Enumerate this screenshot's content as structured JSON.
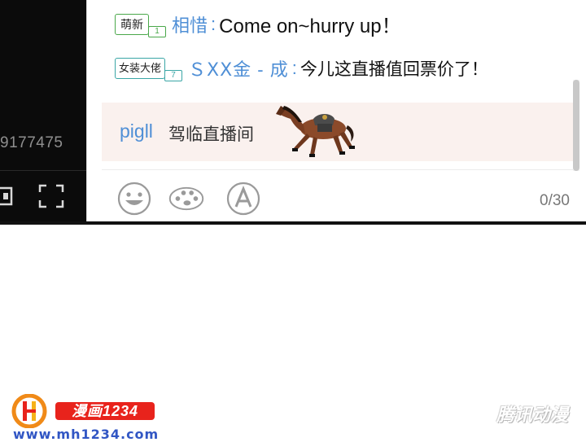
{
  "player": {
    "viewer_count": "9177475"
  },
  "chat": {
    "messages": [
      {
        "badge": "萌新",
        "badge_level": "1",
        "user": "相惜",
        "text": "Come on~hurry up！"
      },
      {
        "badge": "女装大佬",
        "badge_level": "7",
        "user": "ＳⅩⅩ金 - 成",
        "text": "今儿这直播值回票价了！"
      }
    ],
    "notice": {
      "user": "pigll",
      "action": "驾临直播间"
    },
    "input": {
      "char_count": "0/30"
    },
    "toolbar": {
      "emoji_icon": "smile-icon",
      "palette_icon": "palette-icon",
      "font_icon": "font-a-icon"
    }
  },
  "footer": {
    "logo_badge": "漫画1234",
    "site": "www.mh1234.com",
    "watermark": "腾讯动漫"
  },
  "colors": {
    "username_blue": "#4f8fd6",
    "badge_green": "#4aa84a",
    "notice_bg": "#faf1ee",
    "logo_red": "#e8231c"
  }
}
